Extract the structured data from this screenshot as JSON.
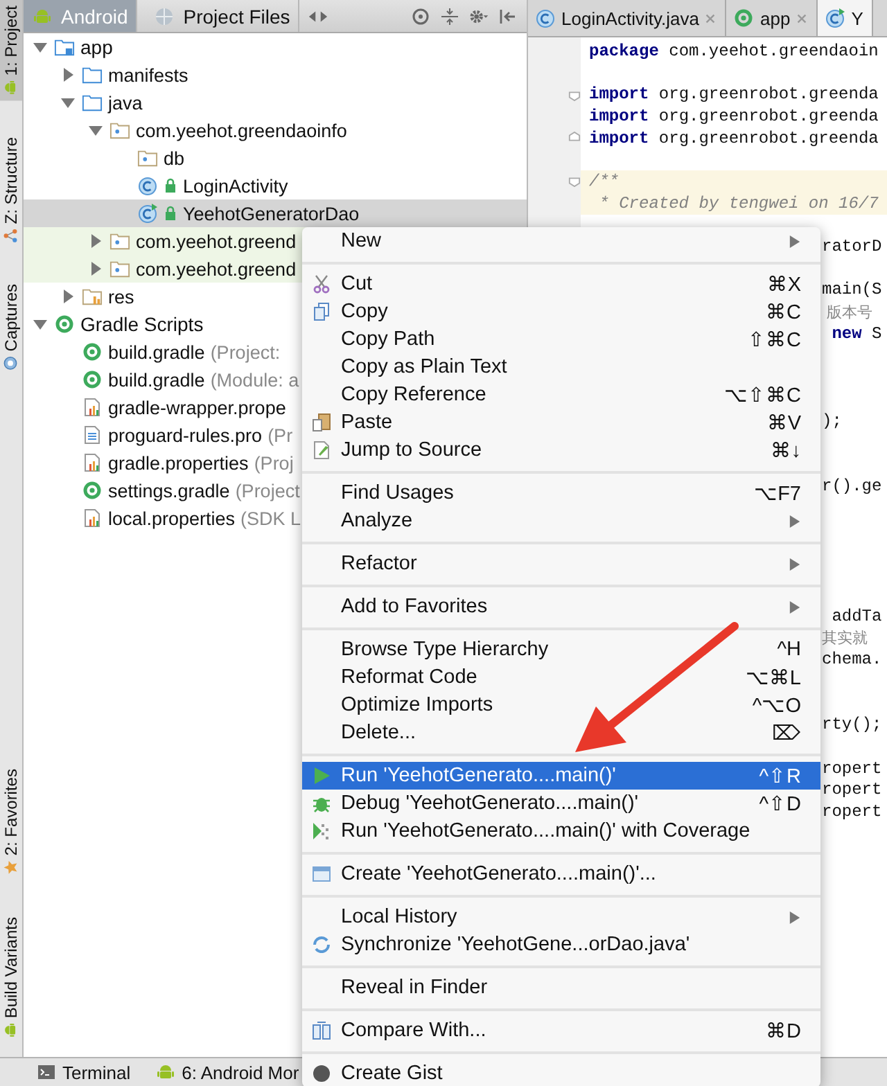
{
  "tool_strip": {
    "top": [
      {
        "label": "1: Project",
        "kind": "android",
        "selected": true
      },
      {
        "label": "Z: Structure",
        "kind": "structure",
        "selected": false
      },
      {
        "label": "Captures",
        "kind": "captures",
        "selected": false
      }
    ],
    "bottom": [
      {
        "label": "2: Favorites",
        "kind": "star",
        "selected": false
      },
      {
        "label": "Build Variants",
        "kind": "android",
        "selected": false
      }
    ]
  },
  "project_panel": {
    "view_tabs": [
      {
        "label": "Android",
        "kind": "android",
        "selected": true
      },
      {
        "label": "Project Files",
        "kind": "globe",
        "selected": false
      }
    ],
    "tree": [
      {
        "label": "app",
        "kind": "module",
        "expanded": true,
        "selected": false,
        "children": [
          {
            "label": "manifests",
            "kind": "folder",
            "expanded": false,
            "selected": false
          },
          {
            "label": "java",
            "kind": "folder",
            "expanded": true,
            "selected": false,
            "children": [
              {
                "label": "com.yeehot.greendaoinfo",
                "kind": "package",
                "expanded": true,
                "selected": false,
                "children": [
                  {
                    "label": "db",
                    "kind": "package",
                    "selected": false
                  },
                  {
                    "label": "LoginActivity",
                    "kind": "class",
                    "selected": false
                  },
                  {
                    "label": "YeehotGeneratorDao",
                    "kind": "runnable_class",
                    "selected": true
                  }
                ]
              },
              {
                "label": "com.yeehot.greend",
                "kind": "test_package",
                "expanded": false,
                "selected": false
              },
              {
                "label": "com.yeehot.greend",
                "kind": "test_package",
                "expanded": false,
                "selected": false
              }
            ]
          },
          {
            "label": "res",
            "kind": "res",
            "expanded": false,
            "selected": false
          }
        ]
      },
      {
        "label": "Gradle Scripts",
        "kind": "gradle",
        "expanded": true,
        "selected": false,
        "children": [
          {
            "label": "build.gradle",
            "note": "(Project:",
            "kind": "gradle",
            "selected": false
          },
          {
            "label": "build.gradle",
            "note": "(Module: a",
            "kind": "gradle",
            "selected": false
          },
          {
            "label": "gradle-wrapper.prope",
            "kind": "properties_file",
            "selected": false
          },
          {
            "label": "proguard-rules.pro",
            "note": "(Pr",
            "kind": "text_file",
            "selected": false
          },
          {
            "label": "gradle.properties",
            "note": "(Proj",
            "kind": "properties_file",
            "selected": false
          },
          {
            "label": "settings.gradle",
            "note": "(Project",
            "kind": "gradle",
            "selected": false
          },
          {
            "label": "local.properties",
            "note": "(SDK L",
            "kind": "properties_file",
            "selected": false
          }
        ]
      }
    ]
  },
  "editor": {
    "tabs": [
      {
        "label": "LoginActivity.java",
        "kind": "class",
        "selected": false
      },
      {
        "label": "app",
        "kind": "gradle",
        "selected": false
      },
      {
        "label": "Y",
        "kind": "runnable_class",
        "selected": true
      }
    ],
    "lines": [
      {
        "segments": [
          {
            "kind": "keyword",
            "text": "package"
          },
          {
            "kind": "plain",
            "text": " com.yeehot.greendaoin"
          }
        ]
      },
      {
        "fold_start": true,
        "segments": [
          {
            "kind": "keyword",
            "text": "import"
          },
          {
            "kind": "plain",
            "text": " org.greenrobot.greenda"
          }
        ]
      },
      {
        "segments": [
          {
            "kind": "keyword",
            "text": "import"
          },
          {
            "kind": "plain",
            "text": " org.greenrobot.greenda"
          }
        ]
      },
      {
        "fold_end": true,
        "segments": [
          {
            "kind": "keyword",
            "text": "import"
          },
          {
            "kind": "plain",
            "text": " org.greenrobot.greenda"
          }
        ]
      },
      {
        "fold_start": true,
        "segments": [
          {
            "kind": "comment",
            "text": "/**"
          }
        ]
      },
      {
        "segments": [
          {
            "kind": "comment",
            "text": " * Created by tengwei on 16/7"
          }
        ]
      }
    ],
    "fragments": [
      {
        "segments": [
          {
            "kind": "plain",
            "text": "ratorD"
          }
        ]
      },
      {
        "segments": [
          {
            "kind": "plain",
            "text": "main(S"
          }
        ]
      },
      {
        "segments": [
          {
            "kind": "hint",
            "text": " 版本号"
          }
        ]
      },
      {
        "segments": [
          {
            "kind": "keyword",
            "text": " new"
          },
          {
            "kind": "plain",
            "text": " S"
          }
        ]
      },
      {
        "segments": [
          {
            "kind": "plain",
            "text": ");"
          }
        ]
      },
      {
        "segments": [
          {
            "kind": "plain",
            "text": "r().ge"
          }
        ]
      },
      {
        "segments": [
          {
            "kind": "plain",
            "text": " addTa"
          }
        ]
      },
      {
        "segments": [
          {
            "kind": "hint",
            "text": "其实就"
          }
        ]
      },
      {
        "segments": [
          {
            "kind": "plain",
            "text": "chema."
          }
        ]
      },
      {
        "segments": [
          {
            "kind": "plain",
            "text": "rty();"
          }
        ]
      },
      {
        "segments": [
          {
            "kind": "plain",
            "text": "ropert"
          }
        ]
      },
      {
        "segments": [
          {
            "kind": "plain",
            "text": "ropert"
          }
        ]
      },
      {
        "segments": [
          {
            "kind": "plain",
            "text": "ropert"
          }
        ]
      }
    ]
  },
  "context_menu": [
    {
      "kind": "plain",
      "label": "New",
      "submenu": true,
      "selected": false
    },
    {
      "kind": "separator"
    },
    {
      "kind": "cut",
      "label": "Cut",
      "shortcut": "⌘X",
      "submenu": false,
      "selected": false
    },
    {
      "kind": "copy",
      "label": "Copy",
      "shortcut": "⌘C",
      "submenu": false,
      "selected": false
    },
    {
      "kind": "plain",
      "label": "Copy Path",
      "shortcut": "⇧⌘C",
      "submenu": false,
      "selected": false
    },
    {
      "kind": "plain",
      "label": "Copy as Plain Text",
      "submenu": false,
      "selected": false
    },
    {
      "kind": "plain",
      "label": "Copy Reference",
      "shortcut": "⌥⇧⌘C",
      "submenu": false,
      "selected": false
    },
    {
      "kind": "paste",
      "label": "Paste",
      "shortcut": "⌘V",
      "submenu": false,
      "selected": false
    },
    {
      "kind": "jump",
      "label": "Jump to Source",
      "shortcut": "⌘↓",
      "submenu": false,
      "selected": false
    },
    {
      "kind": "separator"
    },
    {
      "kind": "plain",
      "label": "Find Usages",
      "shortcut": "⌥F7",
      "submenu": false,
      "selected": false
    },
    {
      "kind": "plain",
      "label": "Analyze",
      "submenu": true,
      "selected": false
    },
    {
      "kind": "separator"
    },
    {
      "kind": "plain",
      "label": "Refactor",
      "submenu": true,
      "selected": false
    },
    {
      "kind": "separator"
    },
    {
      "kind": "plain",
      "label": "Add to Favorites",
      "submenu": true,
      "selected": false
    },
    {
      "kind": "separator"
    },
    {
      "kind": "plain",
      "label": "Browse Type Hierarchy",
      "shortcut": "^H",
      "submenu": false,
      "selected": false
    },
    {
      "kind": "plain",
      "label": "Reformat Code",
      "shortcut": "⌥⌘L",
      "submenu": false,
      "selected": false
    },
    {
      "kind": "plain",
      "label": "Optimize Imports",
      "shortcut": "^⌥O",
      "submenu": false,
      "selected": false
    },
    {
      "kind": "plain",
      "label": "Delete...",
      "shortcut": "⌦",
      "submenu": false,
      "selected": false
    },
    {
      "kind": "separator"
    },
    {
      "kind": "run",
      "label": "Run 'YeehotGenerato....main()'",
      "shortcut": "^⇧R",
      "submenu": false,
      "selected": true
    },
    {
      "kind": "debug",
      "label": "Debug 'YeehotGenerato....main()'",
      "shortcut": "^⇧D",
      "submenu": false,
      "selected": false
    },
    {
      "kind": "coverage",
      "label": "Run 'YeehotGenerato....main()' with Coverage",
      "submenu": false,
      "selected": false
    },
    {
      "kind": "separator"
    },
    {
      "kind": "create",
      "label": "Create 'YeehotGenerato....main()'...",
      "submenu": false,
      "selected": false
    },
    {
      "kind": "separator"
    },
    {
      "kind": "plain",
      "label": "Local History",
      "submenu": true,
      "selected": false
    },
    {
      "kind": "sync",
      "label": "Synchronize 'YeehotGene...orDao.java'",
      "submenu": false,
      "selected": false
    },
    {
      "kind": "separator"
    },
    {
      "kind": "plain",
      "label": "Reveal in Finder",
      "submenu": false,
      "selected": false
    },
    {
      "kind": "separator"
    },
    {
      "kind": "compare",
      "label": "Compare With...",
      "shortcut": "⌘D",
      "submenu": false,
      "selected": false
    },
    {
      "kind": "separator"
    },
    {
      "kind": "gist",
      "label": "Create Gist",
      "submenu": false,
      "selected": false
    }
  ],
  "bottom_bar": [
    {
      "label": "Terminal",
      "kind": "terminal"
    },
    {
      "label": "6: Android Mor",
      "kind": "android"
    }
  ]
}
